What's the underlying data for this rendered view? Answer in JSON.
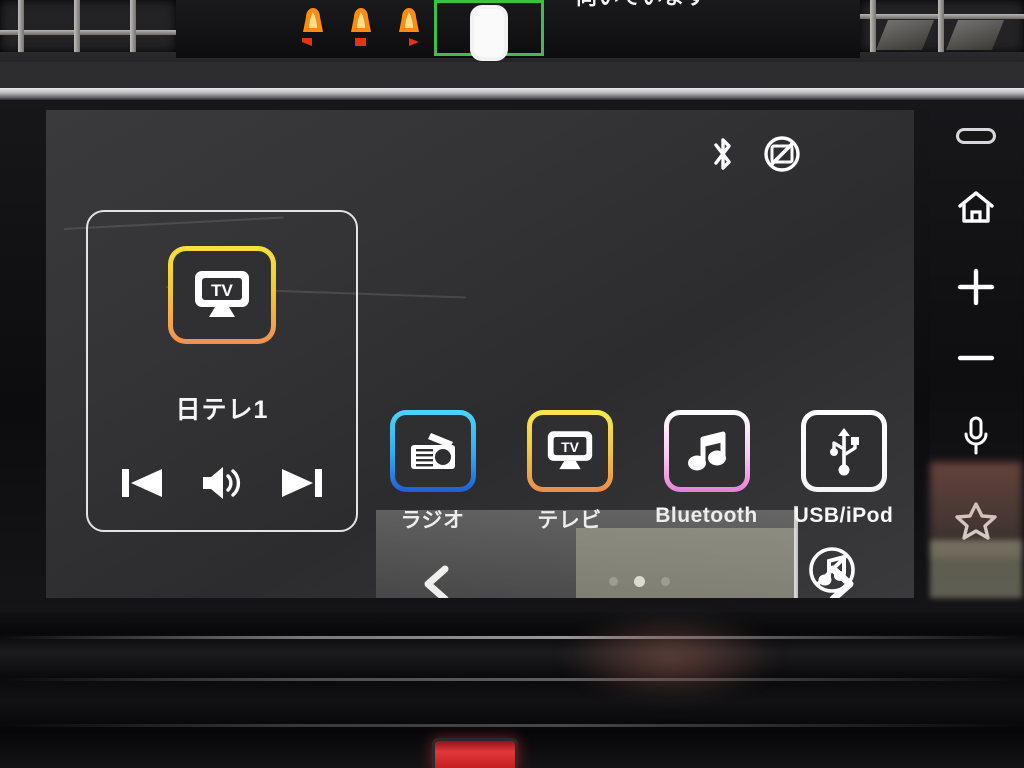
{
  "vehicle_cluster": {
    "seat_indicators": [
      "seat-occupant-left",
      "seat-occupant-center",
      "seat-occupant-right"
    ],
    "car_icon_name": "car-body-icon",
    "message": "向いています"
  },
  "head_unit": {
    "status_bar": {
      "bluetooth_icon": "bluetooth-icon",
      "no_display_icon": "no-display-icon"
    },
    "now_playing": {
      "source_icon": "tv-icon",
      "channel_label": "日テレ1",
      "controls": [
        {
          "name": "previous-button",
          "icon": "skip-previous-icon"
        },
        {
          "name": "volume-button",
          "icon": "speaker-volume-icon"
        },
        {
          "name": "next-button",
          "icon": "skip-next-icon"
        }
      ]
    },
    "apps": [
      {
        "label": "ラジオ",
        "icon": "radio-icon",
        "tile_class": "tile-radio",
        "name": "app-radio"
      },
      {
        "label": "テレビ",
        "icon": "tv-icon",
        "tile_class": "tile-tv",
        "name": "app-tv"
      },
      {
        "label": "Bluetooth",
        "icon": "music-note-icon",
        "tile_class": "tile-bt",
        "name": "app-bluetooth"
      },
      {
        "label": "USB/iPod",
        "icon": "usb-icon",
        "tile_class": "tile-usb",
        "name": "app-usb-ipod"
      }
    ],
    "pager": {
      "prev_icon": "chevron-left-icon",
      "next_icon": "chevron-right-icon",
      "total_pages": 3,
      "current_page": 2
    },
    "overlay": {
      "mute_icon": "mute-music-icon"
    },
    "side_buttons": [
      {
        "name": "card-slot",
        "icon": "slot-icon"
      },
      {
        "name": "home-button",
        "icon": "home-icon"
      },
      {
        "name": "volume-up-button",
        "icon": "plus-icon"
      },
      {
        "name": "volume-down-button",
        "icon": "minus-icon"
      },
      {
        "name": "voice-button",
        "icon": "microphone-icon"
      },
      {
        "name": "favorite-button",
        "icon": "star-icon"
      }
    ]
  },
  "colors": {
    "tv_gradient_top": "#f5e33a",
    "tv_gradient_bottom": "#ef8f55",
    "radio_gradient_top": "#49d7f7",
    "radio_gradient_bottom": "#1d5fd6",
    "bluetooth_gradient_top": "#ffffff",
    "bluetooth_gradient_bottom": "#e87fd8",
    "usb_border": "#ffffff",
    "cluster_green": "#3fbf45",
    "hazard_red": "#e2383a"
  }
}
